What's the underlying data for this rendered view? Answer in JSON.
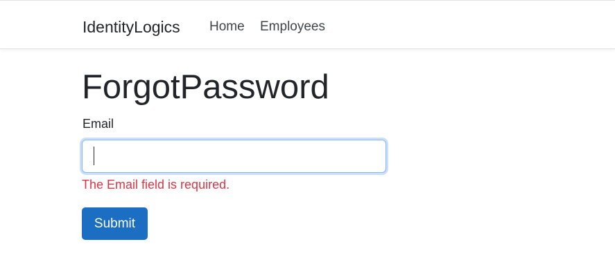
{
  "navbar": {
    "brand": "IdentityLogics",
    "links": [
      {
        "label": "Home"
      },
      {
        "label": "Employees"
      }
    ]
  },
  "main": {
    "title": "ForgotPassword",
    "email_label": "Email",
    "email_value": "",
    "email_error": "The Email field is required.",
    "submit_label": "Submit"
  },
  "colors": {
    "primary": "#1b6ec2",
    "error": "#dc3545",
    "focus_border": "#86b7fe",
    "text": "#212529"
  }
}
